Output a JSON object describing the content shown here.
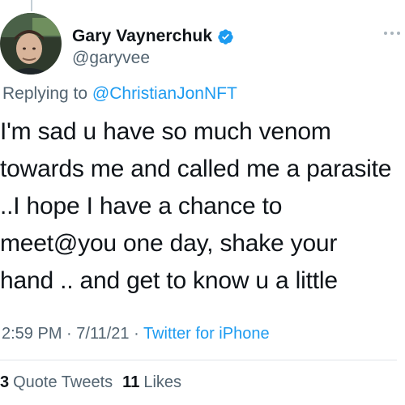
{
  "author": {
    "display_name": "Gary Vaynerchuk",
    "handle": "@garyvee",
    "verified": true
  },
  "reply": {
    "prefix": "Replying to ",
    "mention": "@ChristianJonNFT"
  },
  "tweet": {
    "text": "I'm sad u have so much venom towards me and called me a parasite ..I hope I have a chance to meet@you one day, shake your hand .. and get to know u a little"
  },
  "meta": {
    "time": "2:59 PM",
    "separator1": " · ",
    "date": "7/11/21",
    "separator2": " · ",
    "source": "Twitter for iPhone"
  },
  "stats": {
    "quote_tweets_count": "3",
    "quote_tweets_label": "Quote Tweets",
    "likes_count": "11",
    "likes_label": "Likes"
  },
  "colors": {
    "link": "#1d9bf0",
    "secondary_text": "#536471",
    "primary_text": "#0f1419"
  },
  "icons": [
    "verified-badge-icon",
    "more-options-icon"
  ]
}
